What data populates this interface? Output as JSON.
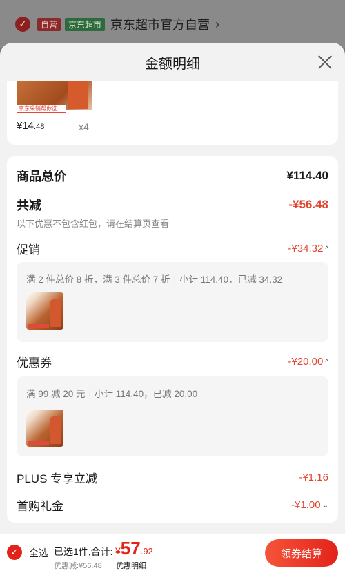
{
  "store": {
    "tag_ziying": "自营",
    "tag_chaoshi": "京东超市",
    "name": "京东超市官方自营",
    "arrow": "›"
  },
  "sheet": {
    "title": "金额明细"
  },
  "product": {
    "tag": "京东采销帮你选",
    "price_int": "¥14",
    "price_dec": ".48",
    "qty": "x4"
  },
  "summary": {
    "total_label": "商品总价",
    "total_value": "¥114.40",
    "discount_label": "共减",
    "discount_value": "-¥56.48",
    "discount_note": "以下优惠不包含红包，请在结算页查看"
  },
  "promotion": {
    "label": "促销",
    "value": "-¥34.32",
    "detail": "满 2 件总价 8 折，满 3 件总价 7 折｜小计 114.40，已减 34.32"
  },
  "coupon": {
    "label": "优惠券",
    "value": "-¥20.00",
    "detail": "满 99 减 20 元｜小计 114.40，已减 20.00"
  },
  "plus": {
    "label": "PLUS 专享立减",
    "value": "-¥1.16"
  },
  "first_gift": {
    "label": "首购礼金",
    "value": "-¥1.00"
  },
  "bottom": {
    "all_label": "全选",
    "selected_info": "已选1件,合计:",
    "currency": "¥",
    "total_int": "57",
    "total_dec": ".92",
    "saved": "优惠减:¥56.48",
    "detail_link": "优惠明细",
    "checkout": "领券结算"
  },
  "colors": {
    "accent_red": "#e2452f",
    "checkout_red": "#e2231a"
  }
}
